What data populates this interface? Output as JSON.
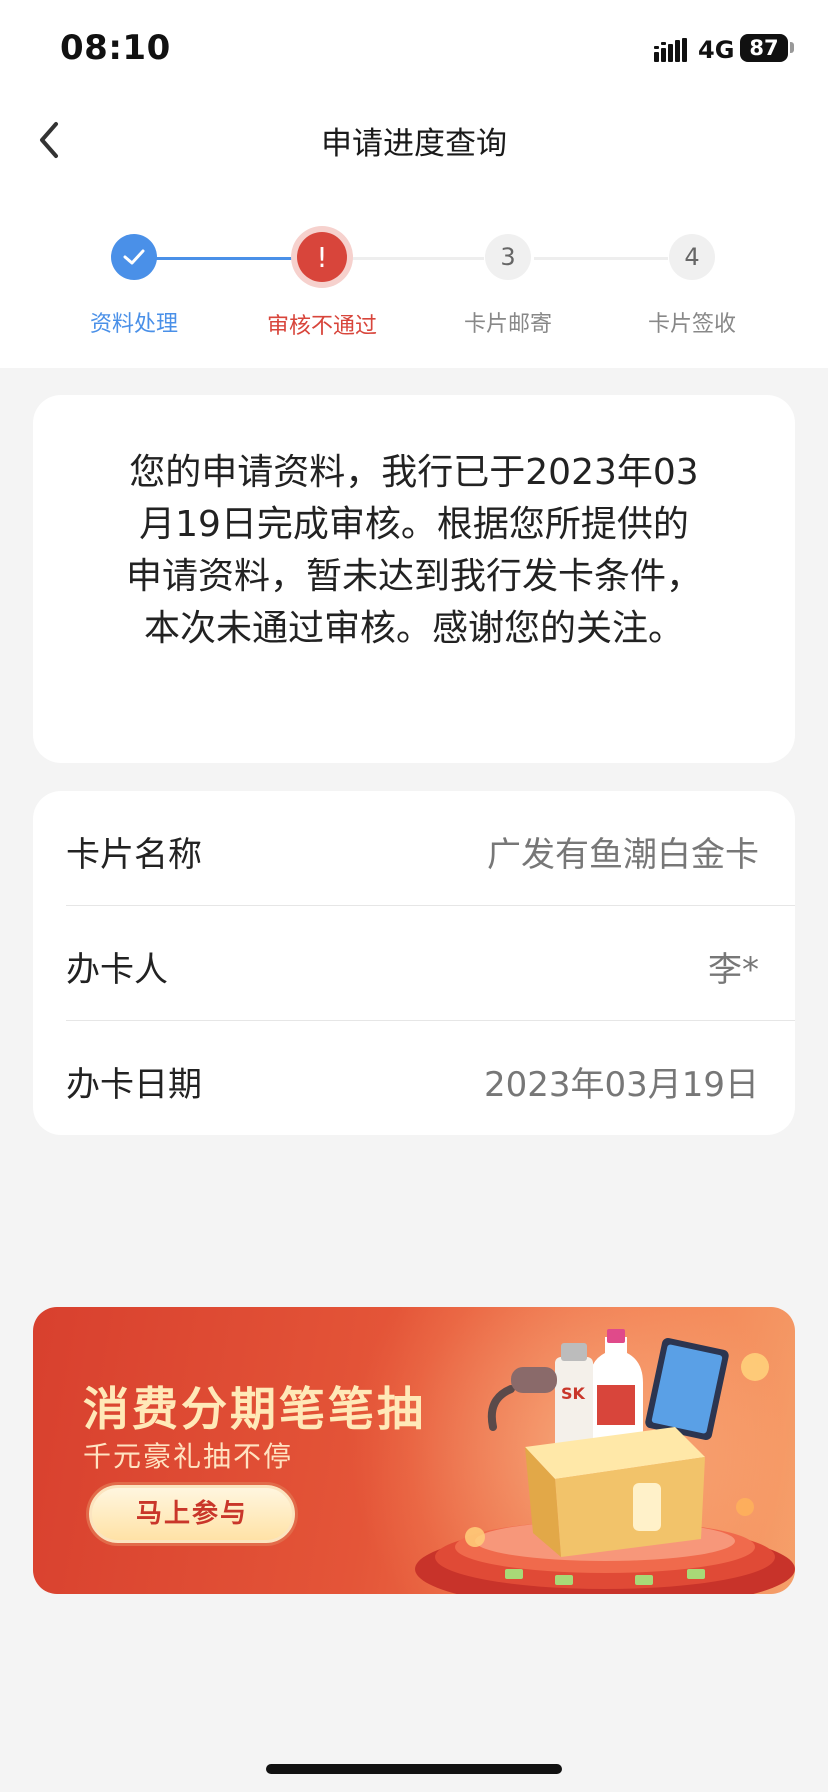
{
  "status_bar": {
    "time": "08:10",
    "network": "4G",
    "battery": "87"
  },
  "nav": {
    "title": "申请进度查询",
    "back_icon": "chevron-left-icon"
  },
  "stepper": {
    "steps": [
      {
        "number": "",
        "label": "资料处理",
        "state": "done"
      },
      {
        "number": "!",
        "label": "审核不通过",
        "state": "error"
      },
      {
        "number": "3",
        "label": "卡片邮寄",
        "state": "pending"
      },
      {
        "number": "4",
        "label": "卡片签收",
        "state": "pending"
      }
    ],
    "colors": {
      "done": "#4a90e8",
      "error": "#d8453b",
      "pending": "#888888"
    }
  },
  "message": {
    "text": "您的申请资料，我行已于2023年03月19日完成审核。根据您所提供的申请资料，暂未达到我行发卡条件，本次未通过审核。感谢您的关注。"
  },
  "info": {
    "rows": [
      {
        "label": "卡片名称",
        "value": "广发有鱼潮白金卡"
      },
      {
        "label": "办卡人",
        "value": "李*"
      },
      {
        "label": "办卡日期",
        "value": "2023年03月19日"
      }
    ]
  },
  "banner": {
    "title": "消费分期笔笔抽",
    "subtitle": "千元豪礼抽不停",
    "button": "马上参与",
    "product_label": "SK"
  }
}
